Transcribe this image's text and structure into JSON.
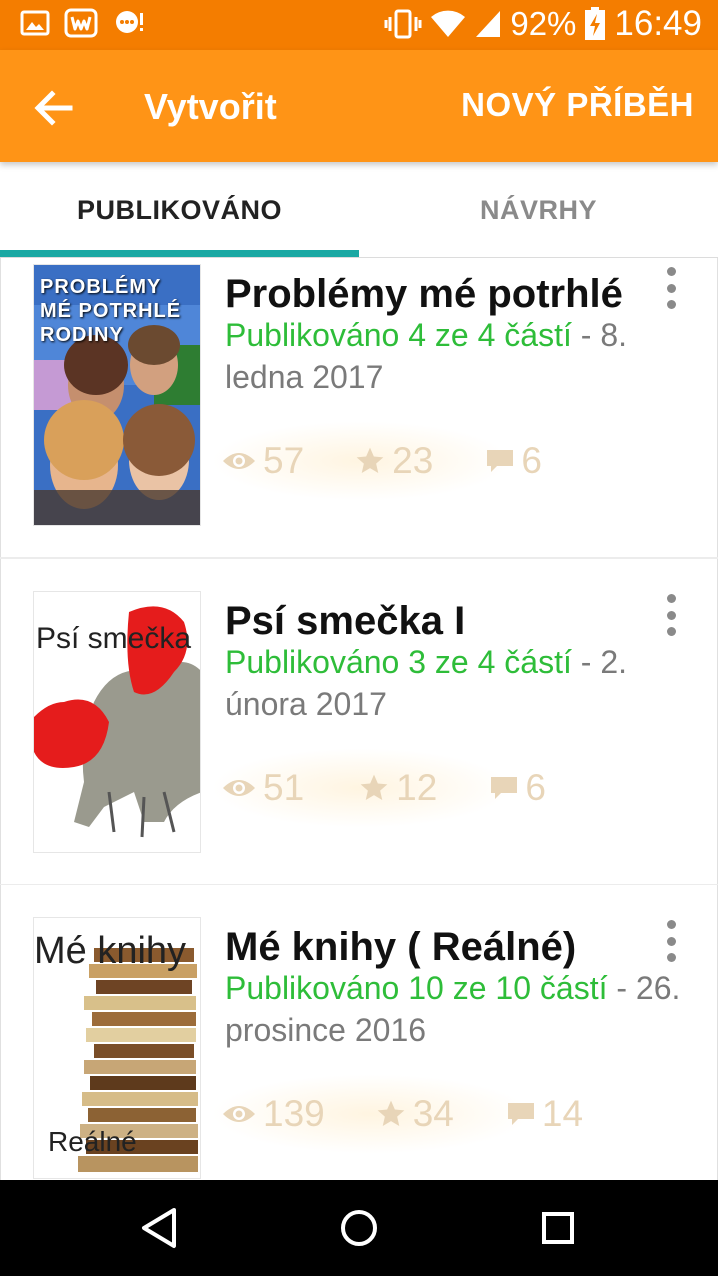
{
  "status_bar": {
    "battery": "92%",
    "time": "16:49",
    "icons": [
      "image-icon",
      "wattpad-notification-icon",
      "chat-notification-icon",
      "vibrate-icon",
      "wifi-icon",
      "signal-icon",
      "battery-charging-icon"
    ]
  },
  "app_bar": {
    "title": "Vytvořit",
    "new_story_label": "NOVÝ PŘÍBĚH",
    "back_icon": "arrow-back-icon"
  },
  "tabs": [
    {
      "label": "PUBLIKOVÁNO",
      "active": true
    },
    {
      "label": "NÁVRHY",
      "active": false
    }
  ],
  "stories": [
    {
      "title": "Problémy mé potrhlé",
      "published": "Publikováno 4 ze 4 částí",
      "date": " - 8. ledna 2017",
      "views": "57",
      "votes": "23",
      "comments": "6",
      "cover_text": "PROBLÉMY MÉ POTRHLÉ RODINY"
    },
    {
      "title": "Psí smečka I",
      "published": "Publikováno 3 ze 4 částí",
      "date": " - 2. února 2017",
      "views": "51",
      "votes": "12",
      "comments": "6",
      "cover_text": "Psí smečka"
    },
    {
      "title": "Mé knihy ( Reálné)",
      "published": "Publikováno 10 ze 10 částí",
      "date": " - 26. prosince 2016",
      "views": "139",
      "votes": "34",
      "comments": "14",
      "cover_text_top": "Mé knihy",
      "cover_text_bottom": "Reálné"
    }
  ],
  "colors": {
    "status_bar": "#f47d00",
    "app_bar": "#ff9416",
    "tab_indicator": "#1aa8a3",
    "published_text": "#2ebd39",
    "stats_text": "#e8d5b8"
  },
  "nav_bar": {
    "icons": [
      "back-triangle-icon",
      "home-circle-icon",
      "recents-square-icon"
    ]
  }
}
